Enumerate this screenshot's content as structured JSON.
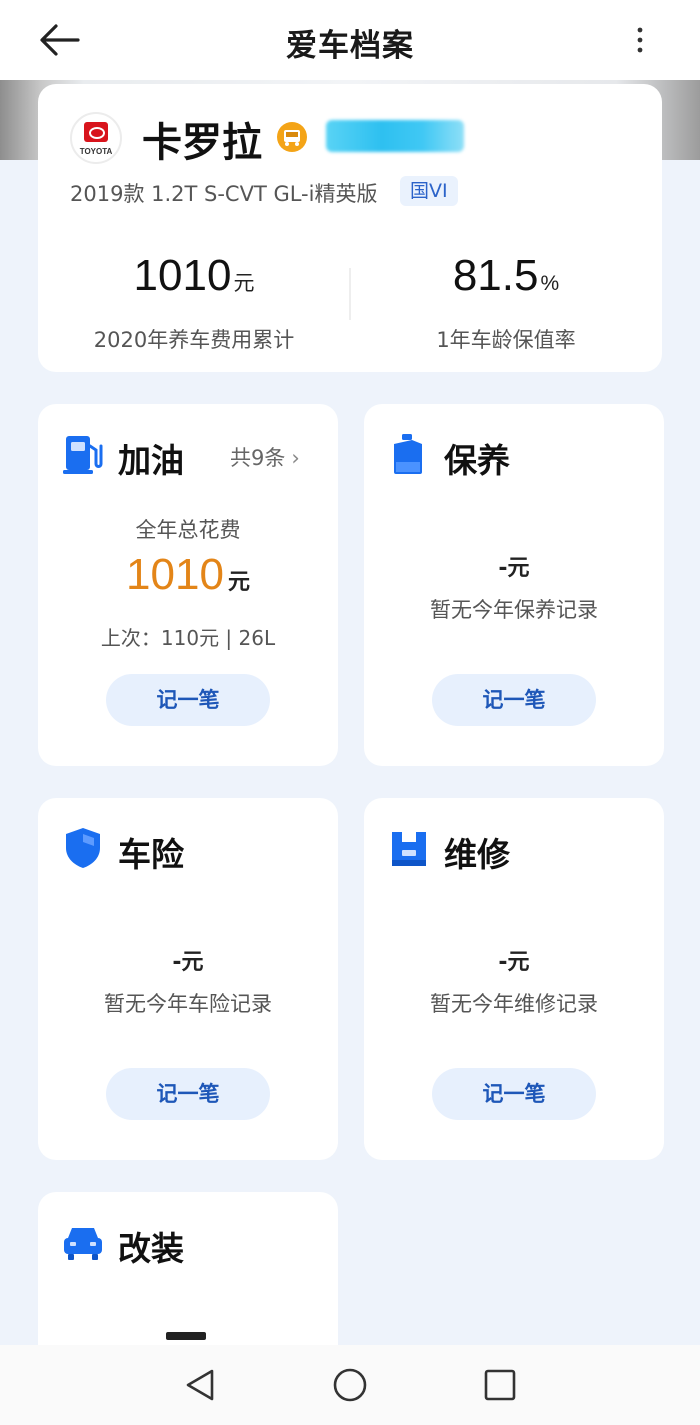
{
  "header": {
    "title": "爱车档案"
  },
  "summary": {
    "car_name": "卡罗拉",
    "logo_text": "TOYOTA",
    "model": "2019款 1.2T S-CVT GL-i精英版",
    "emission": "国VI",
    "cost": {
      "value": "1010",
      "unit": "元",
      "label": "2020年养车费用累计"
    },
    "retention": {
      "value": "81.5",
      "unit": "%",
      "label": "1年车龄保值率"
    }
  },
  "tiles": {
    "fuel": {
      "title": "加油",
      "count": "共9条",
      "caption": "全年总花费",
      "amount": "1010",
      "unit": "元",
      "last": "上次：110元 | 26L",
      "button": "记一笔"
    },
    "maintenance": {
      "title": "保养",
      "amount": "-元",
      "empty": "暂无今年保养记录",
      "button": "记一笔"
    },
    "insurance": {
      "title": "车险",
      "amount": "-元",
      "empty": "暂无今年车险记录",
      "button": "记一笔"
    },
    "repair": {
      "title": "维修",
      "amount": "-元",
      "empty": "暂无今年维修记录",
      "button": "记一笔"
    },
    "modification": {
      "title": "改装"
    }
  },
  "colors": {
    "accent": "#1e57b8",
    "amount_orange": "#e38518",
    "icon_blue": "#1a6ef0",
    "page_bg": "#eef3fb"
  },
  "icons": {
    "back": "arrow-left-icon",
    "more": "more-vertical-icon",
    "fuel": "fuel-pump-icon",
    "maintenance": "oil-can-icon",
    "insurance": "shield-icon",
    "repair": "toolbox-icon",
    "modification": "car-icon"
  }
}
